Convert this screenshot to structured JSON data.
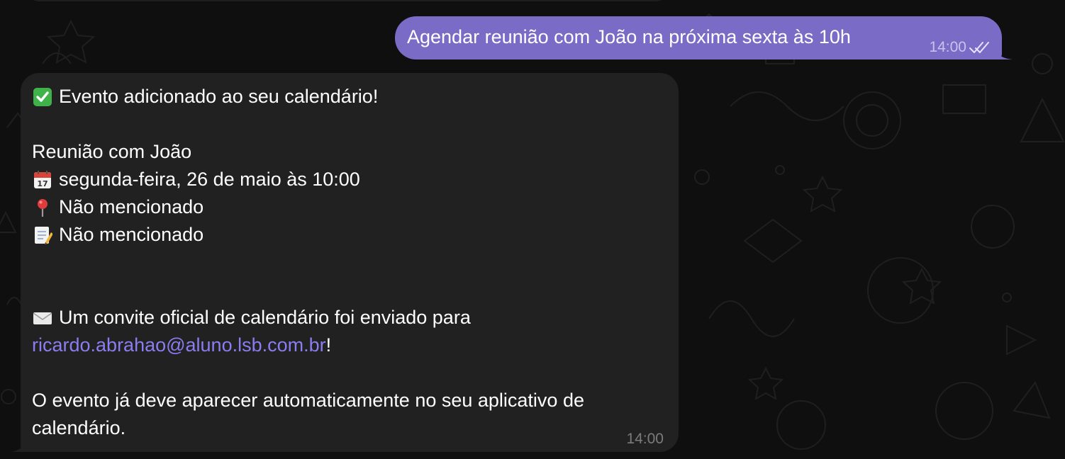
{
  "messages": {
    "outgoing": {
      "text": "Agendar reunião com João na próxima sexta às 10h",
      "time": "14:00",
      "status_icon": "double-check-icon"
    },
    "incoming": {
      "line1": "Evento adicionado ao seu calendário!",
      "title": "Reunião com João",
      "date": "segunda-feira, 26 de maio às 10:00",
      "location": "Não mencionado",
      "notes": "Não mencionado",
      "invite_text": "Um convite oficial de calendário foi enviado para",
      "email": "ricardo.abrahao@aluno.lsb.com.br",
      "exclamation": "!",
      "closing_line1": "O evento já deve aparecer automaticamente no seu aplicativo de",
      "closing_line2": "calendário.",
      "time": "14:00",
      "icons": [
        "check-mark-icon",
        "calendar-icon",
        "pin-icon",
        "memo-icon",
        "envelope-icon"
      ]
    }
  },
  "colors": {
    "outgoing_bubble": "#7a6cc6",
    "incoming_bubble": "#212121",
    "link": "#8b7cf0",
    "background": "#0f0f0f"
  }
}
